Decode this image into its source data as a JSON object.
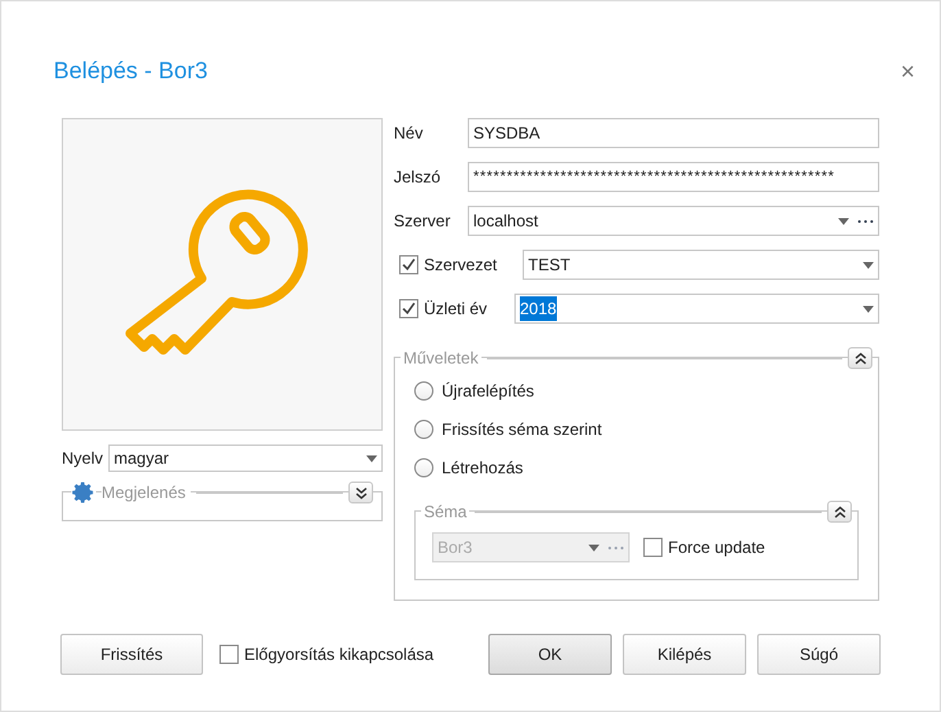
{
  "window": {
    "title": "Belépés - Bor3",
    "close": "×"
  },
  "fields": [
    {
      "label": "Név",
      "value": "SYSDBA",
      "kind": "text"
    },
    {
      "label": "Jelszó",
      "value": "******************************************************",
      "kind": "text"
    },
    {
      "label": "Szerver",
      "value": "localhost",
      "kind": "combo-ellipsis"
    }
  ],
  "options": [
    {
      "label": "Szervezet",
      "checked": true,
      "value": "TEST",
      "value_selected": false
    },
    {
      "label": "Üzleti év",
      "checked": true,
      "value": "2018",
      "value_selected": true
    }
  ],
  "operations": {
    "title": "Műveletek",
    "expanded": true,
    "radios": [
      {
        "label": "Újrafelépítés",
        "selected": false
      },
      {
        "label": "Frissítés séma szerint",
        "selected": false
      },
      {
        "label": "Létrehozás",
        "selected": false
      }
    ],
    "schema": {
      "title": "Séma",
      "expanded": true,
      "value": "Bor3",
      "disabled": true,
      "force_update": {
        "label": "Force update",
        "checked": false
      }
    }
  },
  "language": {
    "label": "Nyelv",
    "value": "magyar"
  },
  "appearance": {
    "title": "Megjelenés",
    "expanded": false
  },
  "footer": {
    "refresh": "Frissítés",
    "precache": {
      "label": "Előgyorsítás kikapcsolása",
      "checked": false
    },
    "buttons": [
      {
        "label": "OK",
        "default": true
      },
      {
        "label": "Kilépés",
        "default": false
      },
      {
        "label": "Súgó",
        "default": false
      }
    ]
  }
}
